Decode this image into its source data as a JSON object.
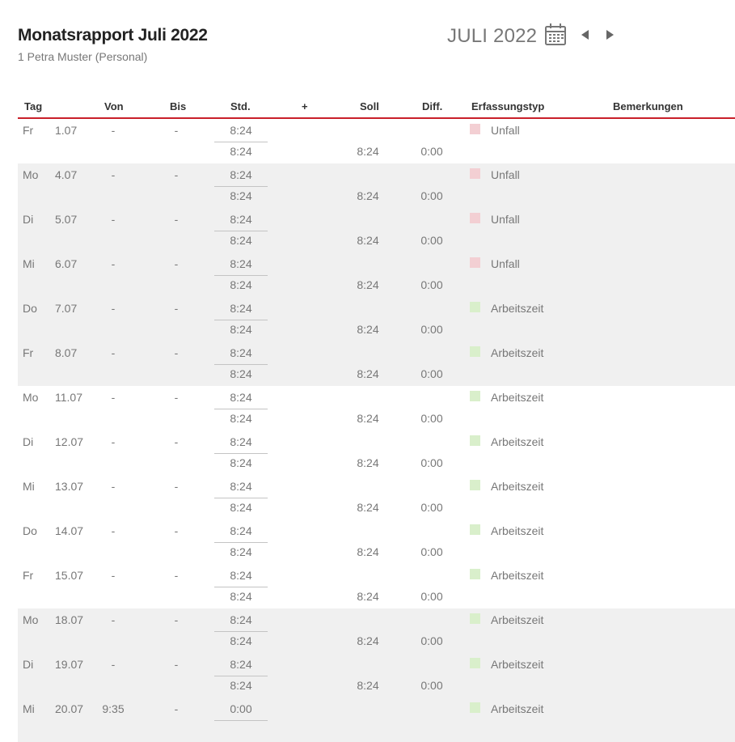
{
  "header": {
    "title": "Monatsrapport Juli 2022",
    "subtitle": "1 Petra Muster (Personal)",
    "month_label": "JULI 2022",
    "calendar_icon": "calendar-icon",
    "prev_icon": "triangle-left-icon",
    "next_icon": "triangle-right-icon"
  },
  "table": {
    "columns": {
      "tag": "Tag",
      "von": "Von",
      "bis": "Bis",
      "std": "Std.",
      "plus": "+",
      "soll": "Soll",
      "diff": "Diff.",
      "erfassungstyp": "Erfassungstyp",
      "bemerkungen": "Bemerkungen"
    },
    "type_colors": {
      "Unfall": "#f3cfd3",
      "Arbeitszeit": "#d9efcb"
    },
    "rows": [
      {
        "weekday": "Fr",
        "date": "1.07",
        "von": "-",
        "bis": "-",
        "std": "8:24",
        "std_total": "8:24",
        "soll": "8:24",
        "diff": "0:00",
        "type": "Unfall",
        "shaded": false
      },
      {
        "weekday": "Mo",
        "date": "4.07",
        "von": "-",
        "bis": "-",
        "std": "8:24",
        "std_total": "8:24",
        "soll": "8:24",
        "diff": "0:00",
        "type": "Unfall",
        "shaded": true
      },
      {
        "weekday": "Di",
        "date": "5.07",
        "von": "-",
        "bis": "-",
        "std": "8:24",
        "std_total": "8:24",
        "soll": "8:24",
        "diff": "0:00",
        "type": "Unfall",
        "shaded": true
      },
      {
        "weekday": "Mi",
        "date": "6.07",
        "von": "-",
        "bis": "-",
        "std": "8:24",
        "std_total": "8:24",
        "soll": "8:24",
        "diff": "0:00",
        "type": "Unfall",
        "shaded": true
      },
      {
        "weekday": "Do",
        "date": "7.07",
        "von": "-",
        "bis": "-",
        "std": "8:24",
        "std_total": "8:24",
        "soll": "8:24",
        "diff": "0:00",
        "type": "Arbeitszeit",
        "shaded": true
      },
      {
        "weekday": "Fr",
        "date": "8.07",
        "von": "-",
        "bis": "-",
        "std": "8:24",
        "std_total": "8:24",
        "soll": "8:24",
        "diff": "0:00",
        "type": "Arbeitszeit",
        "shaded": true
      },
      {
        "weekday": "Mo",
        "date": "11.07",
        "von": "-",
        "bis": "-",
        "std": "8:24",
        "std_total": "8:24",
        "soll": "8:24",
        "diff": "0:00",
        "type": "Arbeitszeit",
        "shaded": false
      },
      {
        "weekday": "Di",
        "date": "12.07",
        "von": "-",
        "bis": "-",
        "std": "8:24",
        "std_total": "8:24",
        "soll": "8:24",
        "diff": "0:00",
        "type": "Arbeitszeit",
        "shaded": false
      },
      {
        "weekday": "Mi",
        "date": "13.07",
        "von": "-",
        "bis": "-",
        "std": "8:24",
        "std_total": "8:24",
        "soll": "8:24",
        "diff": "0:00",
        "type": "Arbeitszeit",
        "shaded": false
      },
      {
        "weekday": "Do",
        "date": "14.07",
        "von": "-",
        "bis": "-",
        "std": "8:24",
        "std_total": "8:24",
        "soll": "8:24",
        "diff": "0:00",
        "type": "Arbeitszeit",
        "shaded": false
      },
      {
        "weekday": "Fr",
        "date": "15.07",
        "von": "-",
        "bis": "-",
        "std": "8:24",
        "std_total": "8:24",
        "soll": "8:24",
        "diff": "0:00",
        "type": "Arbeitszeit",
        "shaded": false
      },
      {
        "weekday": "Mo",
        "date": "18.07",
        "von": "-",
        "bis": "-",
        "std": "8:24",
        "std_total": "8:24",
        "soll": "8:24",
        "diff": "0:00",
        "type": "Arbeitszeit",
        "shaded": true
      },
      {
        "weekday": "Di",
        "date": "19.07",
        "von": "-",
        "bis": "-",
        "std": "8:24",
        "std_total": "8:24",
        "soll": "8:24",
        "diff": "0:00",
        "type": "Arbeitszeit",
        "shaded": true
      },
      {
        "weekday": "Mi",
        "date": "20.07",
        "von": "9:35",
        "bis": "-",
        "std": "0:00",
        "std_total": "",
        "soll": "",
        "diff": "",
        "type": "Arbeitszeit",
        "shaded": true
      }
    ]
  }
}
